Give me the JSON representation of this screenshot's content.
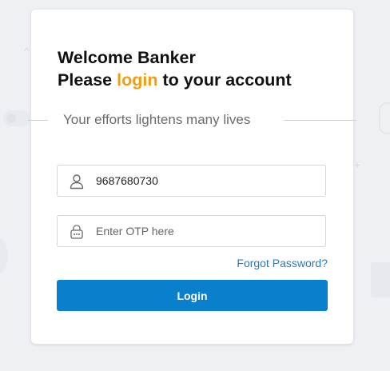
{
  "heading": {
    "line1": "Welcome Banker",
    "line2_prefix": "Please ",
    "line2_accent": "login",
    "line2_suffix": " to your account"
  },
  "tagline": "Your efforts lightens many lives",
  "phone_field": {
    "icon": "user-icon",
    "value": "9687680730",
    "placeholder": ""
  },
  "otp_field": {
    "icon": "otp-lock-icon",
    "value": "",
    "placeholder": "Enter OTP here"
  },
  "forgot_password": "Forgot Password?",
  "login_button": "Login",
  "colors": {
    "accent": "#f39c12",
    "primary": "#0a80cc",
    "link": "#2a7ab8",
    "background": "#eef0f3"
  }
}
